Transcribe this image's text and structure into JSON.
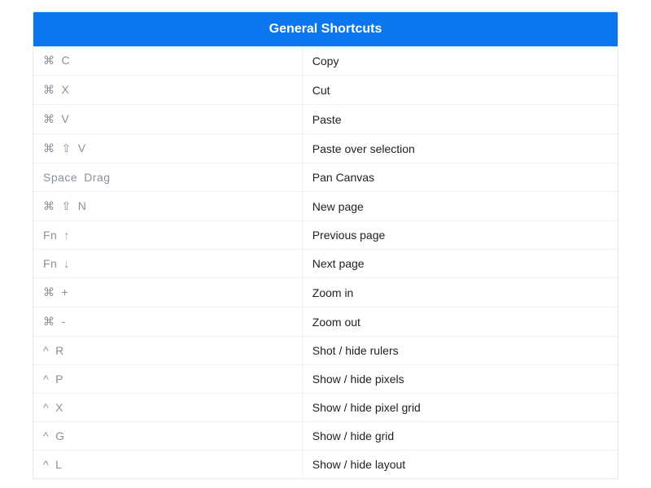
{
  "title": "General Shortcuts",
  "rows": [
    {
      "keys": [
        "⌘",
        "C"
      ],
      "desc": "Copy"
    },
    {
      "keys": [
        "⌘",
        "X"
      ],
      "desc": "Cut"
    },
    {
      "keys": [
        "⌘",
        "V"
      ],
      "desc": "Paste"
    },
    {
      "keys": [
        "⌘",
        "⇧",
        "V"
      ],
      "desc": "Paste over selection"
    },
    {
      "keys": [
        "Space",
        "Drag"
      ],
      "desc": "Pan Canvas"
    },
    {
      "keys": [
        "⌘",
        "⇧",
        "N"
      ],
      "desc": "New page"
    },
    {
      "keys": [
        "Fn",
        "↑"
      ],
      "desc": "Previous page"
    },
    {
      "keys": [
        "Fn",
        "↓"
      ],
      "desc": "Next page"
    },
    {
      "keys": [
        "⌘",
        "+"
      ],
      "desc": "Zoom in"
    },
    {
      "keys": [
        "⌘",
        "-"
      ],
      "desc": "Zoom out"
    },
    {
      "keys": [
        "^",
        "R"
      ],
      "desc": "Shot / hide rulers"
    },
    {
      "keys": [
        "^",
        "P"
      ],
      "desc": "Show / hide pixels"
    },
    {
      "keys": [
        "^",
        "X"
      ],
      "desc": "Show / hide pixel grid"
    },
    {
      "keys": [
        "^",
        "G"
      ],
      "desc": "Show / hide grid"
    },
    {
      "keys": [
        "^",
        "L"
      ],
      "desc": "Show / hide layout"
    }
  ]
}
